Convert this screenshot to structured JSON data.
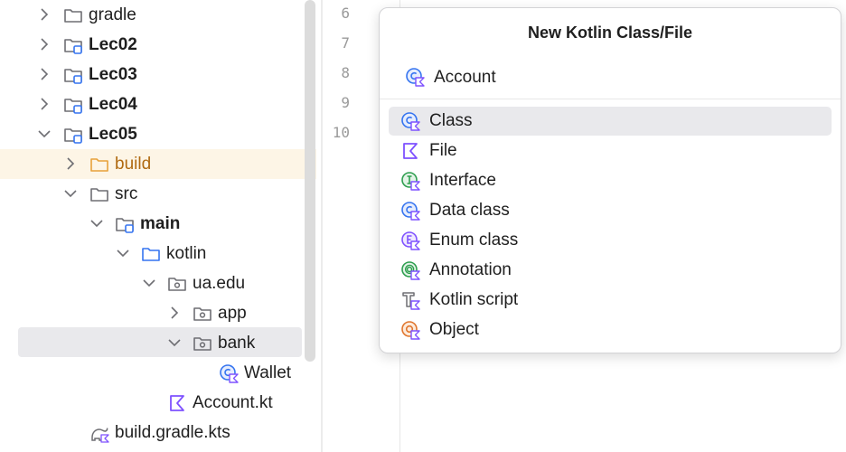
{
  "project_tree": {
    "items": [
      {
        "label": "gradle",
        "icon": "folder-icon",
        "expanded": false,
        "bold": false
      },
      {
        "label": "Lec02",
        "icon": "module-folder-icon",
        "expanded": false,
        "bold": true
      },
      {
        "label": "Lec03",
        "icon": "module-folder-icon",
        "expanded": false,
        "bold": true
      },
      {
        "label": "Lec04",
        "icon": "module-folder-icon",
        "expanded": false,
        "bold": true
      },
      {
        "label": "Lec05",
        "icon": "module-folder-icon",
        "expanded": true,
        "bold": true
      },
      {
        "label": "build",
        "icon": "excluded-folder-icon",
        "expanded": false,
        "bold": false
      },
      {
        "label": "src",
        "icon": "folder-icon",
        "expanded": true,
        "bold": false
      },
      {
        "label": "main",
        "icon": "source-set-folder-icon",
        "expanded": true,
        "bold": true
      },
      {
        "label": "kotlin",
        "icon": "source-root-folder-icon",
        "expanded": true,
        "bold": false
      },
      {
        "label": "ua.edu",
        "icon": "package-icon",
        "expanded": true,
        "bold": false
      },
      {
        "label": "app",
        "icon": "package-icon",
        "expanded": false,
        "bold": false
      },
      {
        "label": "bank",
        "icon": "package-icon",
        "expanded": true,
        "bold": false
      },
      {
        "label": "Wallet",
        "icon": "kotlin-class-icon",
        "bold": false
      },
      {
        "label": "Account.kt",
        "icon": "kotlin-file-icon",
        "bold": false
      },
      {
        "label": "build.gradle.kts",
        "icon": "gradle-icon",
        "bold": false
      }
    ]
  },
  "editor": {
    "line_numbers": [
      "6",
      "7",
      "8",
      "9",
      "10"
    ]
  },
  "dialog": {
    "title": "New Kotlin Class/File",
    "name_value": "Account",
    "kinds": [
      {
        "label": "Class",
        "icon": "kotlin-class-icon",
        "selected": true
      },
      {
        "label": "File",
        "icon": "kotlin-file-icon",
        "selected": false
      },
      {
        "label": "Interface",
        "icon": "kotlin-interface-icon",
        "selected": false
      },
      {
        "label": "Data class",
        "icon": "kotlin-data-class-icon",
        "selected": false
      },
      {
        "label": "Enum class",
        "icon": "kotlin-enum-icon",
        "selected": false
      },
      {
        "label": "Annotation",
        "icon": "kotlin-annotation-icon",
        "selected": false
      },
      {
        "label": "Kotlin script",
        "icon": "kotlin-script-icon",
        "selected": false
      },
      {
        "label": "Object",
        "icon": "kotlin-object-icon",
        "selected": false
      }
    ]
  },
  "colors": {
    "kotlin_purple": "#7f52ff",
    "class_blue": "#3574f0",
    "interface_green": "#2e9e4f",
    "object_orange": "#e0752d",
    "module_blue": "#3574f0",
    "excluded_orange": "#e8a23a",
    "selection_bg": "#e9e9ec"
  }
}
